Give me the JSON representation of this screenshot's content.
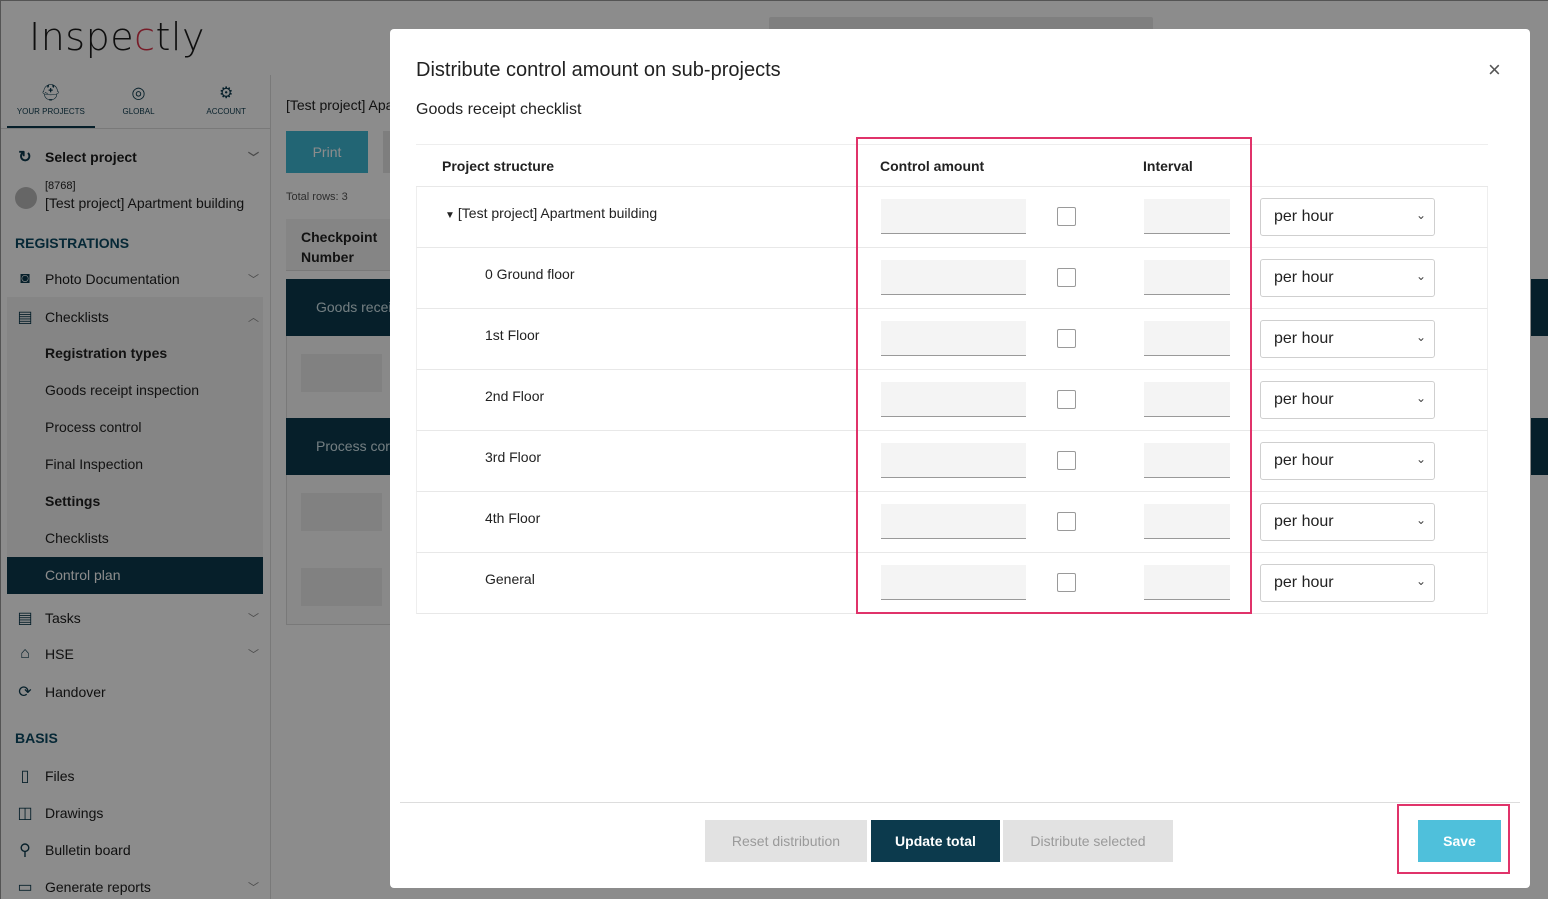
{
  "app": {
    "logo": "Inspectly",
    "sidebar": {
      "tabs": [
        {
          "label": "YOUR PROJECTS",
          "icon": "helmet-icon"
        },
        {
          "label": "GLOBAL",
          "icon": "globe-icon"
        },
        {
          "label": "ACCOUNT",
          "icon": "gear-icon"
        }
      ],
      "select_project": "Select project",
      "project_id": "[8768]",
      "project_name": "[Test project] Apartment building",
      "registrations_heading": "REGISTRATIONS",
      "photo_documentation": "Photo Documentation",
      "checklists": "Checklists",
      "registration_types": "Registration types",
      "goods_receipt_inspection": "Goods receipt inspection",
      "process_control": "Process control",
      "final_inspection": "Final Inspection",
      "settings": "Settings",
      "checklists_sub": "Checklists",
      "control_plan": "Control plan",
      "tasks": "Tasks",
      "hse": "HSE",
      "handover": "Handover",
      "basis_heading": "BASIS",
      "files": "Files",
      "drawings": "Drawings",
      "bulletin_board": "Bulletin board",
      "generate_reports": "Generate reports"
    },
    "main": {
      "breadcrumb": "[Test project] Apa",
      "print_label": "Print",
      "total_rows": "Total rows: 3",
      "checkpoint_header": "Checkpoint Number",
      "band1": "Goods recei",
      "band2": "Process cor"
    }
  },
  "modal": {
    "title": "Distribute control amount on sub-projects",
    "subtitle": "Goods receipt checklist",
    "columns": {
      "project_structure": "Project structure",
      "control_amount": "Control amount",
      "interval": "Interval"
    },
    "rows": [
      {
        "name": "[Test project] Apartment building",
        "interval_unit": "per hour",
        "is_root": true
      },
      {
        "name": "0 Ground floor",
        "interval_unit": "per hour"
      },
      {
        "name": "1st Floor",
        "interval_unit": "per hour"
      },
      {
        "name": "2nd Floor",
        "interval_unit": "per hour"
      },
      {
        "name": "3rd Floor",
        "interval_unit": "per hour"
      },
      {
        "name": "4th Floor",
        "interval_unit": "per hour"
      },
      {
        "name": "General",
        "interval_unit": "per hour"
      }
    ],
    "buttons": {
      "reset": "Reset distribution",
      "update": "Update total",
      "distribute": "Distribute selected",
      "save": "Save"
    },
    "close_icon": "×"
  },
  "colors": {
    "primary_dark": "#0c3a4d",
    "accent": "#4fc0db",
    "highlight": "#e0336a"
  }
}
